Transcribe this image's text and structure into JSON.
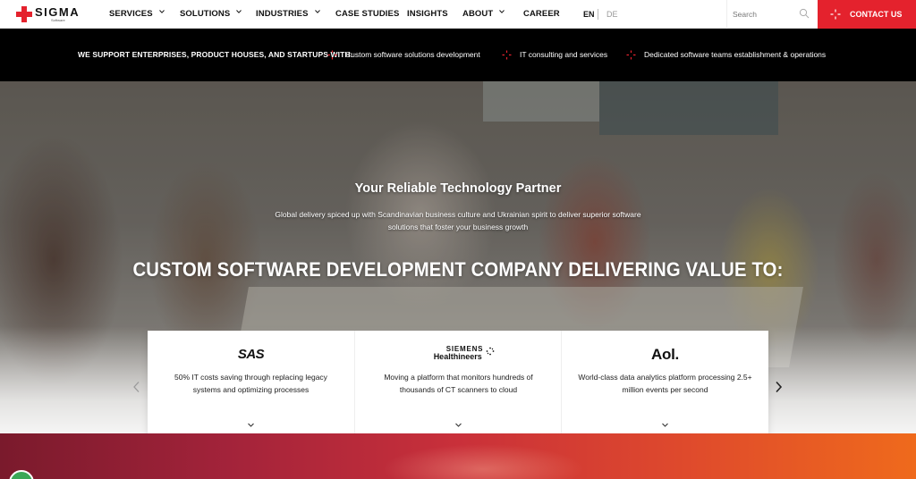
{
  "brand": {
    "logo_text": "SIGMA",
    "logo_subtext": "Software"
  },
  "nav": {
    "items": [
      {
        "label": "SERVICES",
        "has_dropdown": true
      },
      {
        "label": "SOLUTIONS",
        "has_dropdown": true
      },
      {
        "label": "INDUSTRIES",
        "has_dropdown": true
      },
      {
        "label": "CASE STUDIES",
        "has_dropdown": false
      },
      {
        "label": "INSIGHTS",
        "has_dropdown": false
      },
      {
        "label": "ABOUT",
        "has_dropdown": true
      },
      {
        "label": "CAREER",
        "has_dropdown": false
      }
    ],
    "languages": [
      {
        "label": "EN",
        "active": true
      },
      {
        "label": "DE",
        "active": false
      }
    ],
    "search": {
      "placeholder": "Search",
      "value": ""
    },
    "contact_label": "CONTACT US"
  },
  "support_bar": {
    "lead": "WE SUPPORT ENTERPRISES, PRODUCT HOUSES, AND STARTUPS WITH:",
    "items": [
      "Custom software solutions development",
      "IT consulting and services",
      "Dedicated software teams establishment & operations"
    ]
  },
  "hero": {
    "tagline": "Your Reliable Technology Partner",
    "subtitle": "Global delivery spiced up with Scandinavian business culture and Ukrainian spirit to deliver superior software solutions that foster your business growth",
    "headline": "CUSTOM SOFTWARE DEVELOPMENT COMPANY DELIVERING VALUE TO:"
  },
  "cases": [
    {
      "brand": "SAS",
      "description": "50% IT costs saving through replacing legacy systems and optimizing processes"
    },
    {
      "brand_line1": "SIEMENS",
      "brand_line2": "Healthineers",
      "description": "Moving a platform that monitors hundreds of thousands of CT scanners to cloud"
    },
    {
      "brand": "Aol.",
      "description": "World-class data analytics platform processing 2.5+ million events per second"
    }
  ],
  "colors": {
    "accent": "#e4222d",
    "support_bar_bg": "#000000",
    "band_start": "#7a1a2c",
    "band_end": "#ef6a1c"
  },
  "icons": [
    "logo-cross-icon",
    "chevron-down-icon",
    "search-icon",
    "sparkle-icon",
    "chevron-left-icon",
    "chevron-right-icon",
    "siemens-dots-icon",
    "chat-icon"
  ]
}
